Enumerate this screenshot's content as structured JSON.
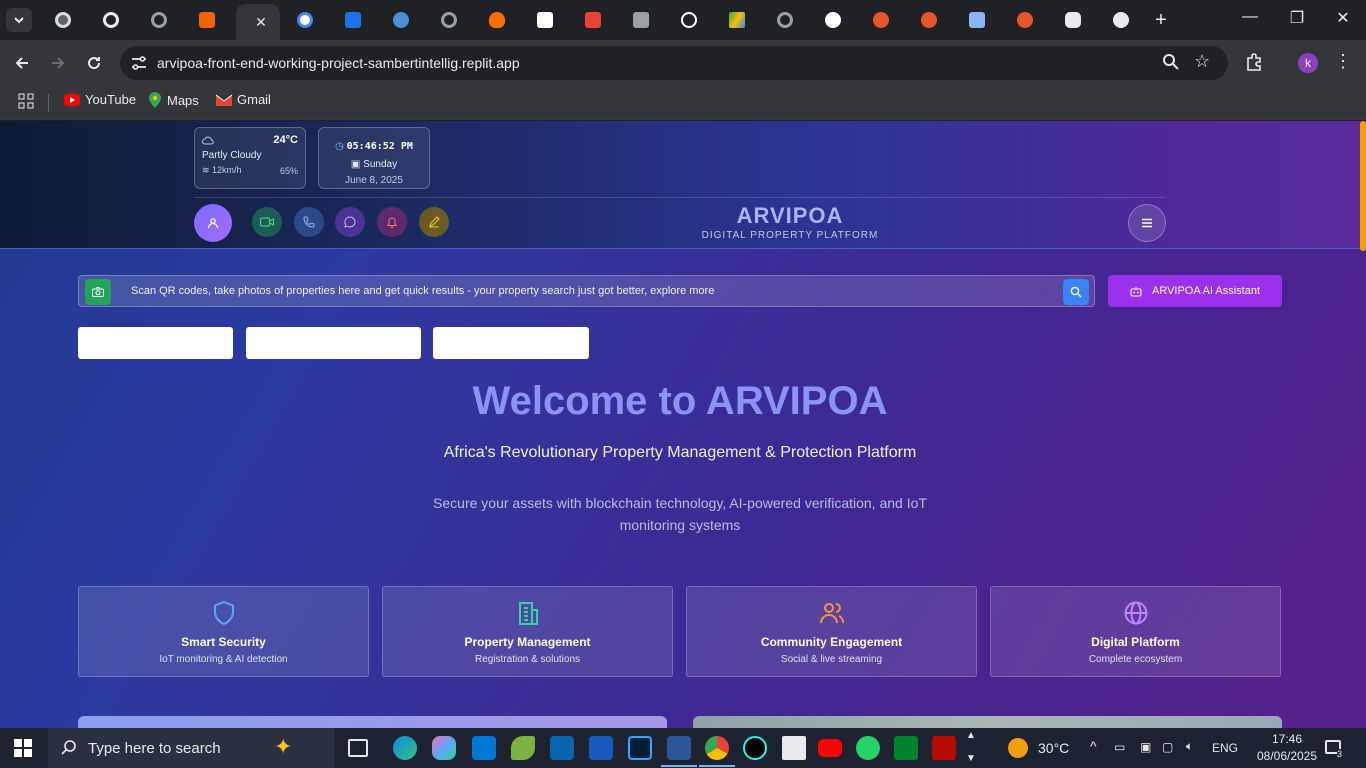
{
  "browser": {
    "url": "arvipoa-front-end-working-project-sambertintellig.replit.app",
    "profile_initial": "k",
    "bookmarks": [
      {
        "label": "YouTube",
        "icon": "youtube-icon"
      },
      {
        "label": "Maps",
        "icon": "maps-icon"
      },
      {
        "label": "Gmail",
        "icon": "gmail-icon"
      }
    ]
  },
  "header": {
    "weather": {
      "temperature": "24°C",
      "condition": "Partly Cloudy",
      "wind": "12km/h",
      "humidity": "65%"
    },
    "clock": {
      "time": "05:46:52 PM",
      "day": "Sunday",
      "date": "June 8, 2025"
    },
    "brand": {
      "name": "ARVIPOA",
      "tagline": "DIGITAL PROPERTY PLATFORM"
    }
  },
  "search": {
    "text": "Scan QR codes, take photos of properties here and get quick results - your property search just got better, explore more"
  },
  "ai_button_label": "ARVIPOA AI Assistant",
  "hero": {
    "title": "Welcome to ARVIPOA",
    "subtitle": "Africa's Revolutionary Property Management & Protection Platform",
    "description": "Secure your assets with blockchain technology, AI-powered verification, and IoT monitoring systems"
  },
  "features": [
    {
      "title": "Smart Security",
      "desc": "IoT monitoring & AI detection",
      "icon": "shield-icon",
      "color": "#60a5fa"
    },
    {
      "title": "Property Management",
      "desc": "Registration & solutions",
      "icon": "building-icon",
      "color": "#34d399"
    },
    {
      "title": "Community Engagement",
      "desc": "Social & live streaming",
      "icon": "users-icon",
      "color": "#fb923c"
    },
    {
      "title": "Digital Platform",
      "desc": "Complete ecosystem",
      "icon": "globe-icon",
      "color": "#c084fc"
    }
  ],
  "taskbar": {
    "search_placeholder": "Type here to search",
    "weather": "30°C",
    "language": "ENG",
    "time": "17:46",
    "date": "08/06/2025",
    "notifications": "3"
  }
}
